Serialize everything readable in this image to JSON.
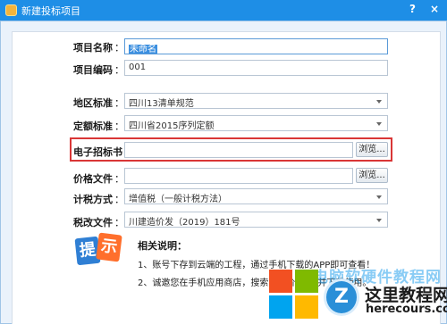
{
  "window": {
    "title": "新建投标项目",
    "help_label": "?",
    "close_label": "×"
  },
  "form": {
    "project_name": {
      "label": "项目名称",
      "colon": "：",
      "value": "未命名"
    },
    "project_code": {
      "label": "项目编码",
      "colon": "：",
      "value": "001"
    },
    "region_standard": {
      "label": "地区标准",
      "colon": "：",
      "value": "四川13清单规范"
    },
    "quota_standard": {
      "label": "定额标准",
      "colon": "：",
      "value": "四川省2015序列定额"
    },
    "electronic_bid": {
      "label": "电子招标书",
      "colon": "：",
      "value": "",
      "browse_label": "浏览..."
    },
    "price_file": {
      "label": "价格文件",
      "colon": "：",
      "value": "",
      "browse_label": "浏览..."
    },
    "tax_method": {
      "label": "计税方式",
      "colon": "：",
      "value": "增值税（一般计税方法）"
    },
    "tax_document": {
      "label": "税改文件",
      "colon": "：",
      "value": "川建造价发（2019）181号"
    }
  },
  "tips": {
    "icon_text_1": "提",
    "icon_text_2": "示",
    "title": "相关说明：",
    "items": [
      "1、账号下存到云端的工程，通过手机下载的APP即可查看！",
      "2、诚邀您在手机应用商店，搜索【造价云】，并下载使用。"
    ]
  },
  "watermark": {
    "text": "电脑软硬件教程网",
    "site_name": "这里教程网",
    "site_url": "herecours.com",
    "logo_letter": "Z"
  }
}
